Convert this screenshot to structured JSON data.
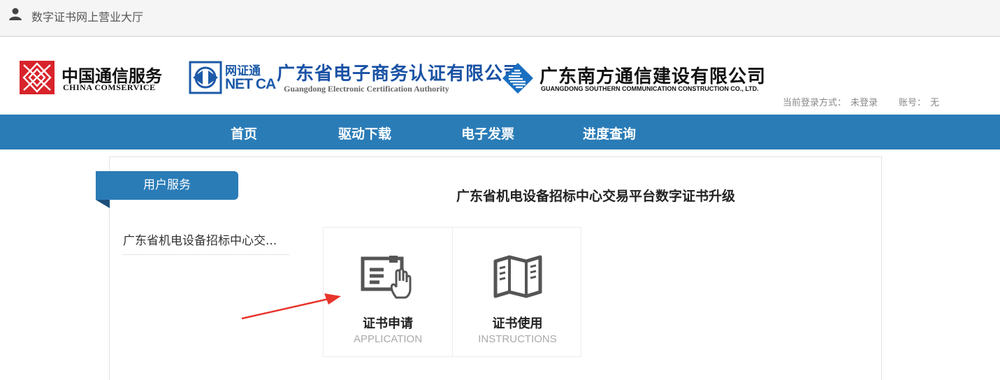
{
  "topbar": {
    "title": "数字证书网上营业大厅",
    "icon": "user-icon"
  },
  "logos": {
    "china_comservice": {
      "cn": "中国通信服务",
      "en": "CHINA COMSERVICE"
    },
    "netca": {
      "cn": "网证通",
      "en": "NET CA"
    },
    "gdca": {
      "cn": "广东省电子商务认证有限公司",
      "en": "Guangdong Electronic Certification Authority"
    },
    "gdsctc": {
      "cn": "广东南方通信建设有限公司",
      "en": "GUANGDONG SOUTHERN COMMUNICATION CONSTRUCTION CO., LTD."
    }
  },
  "login": {
    "method_label": "当前登录方式：",
    "method_value": "未登录",
    "account_label": "账号：",
    "account_value": "无"
  },
  "nav": [
    {
      "label": "首页"
    },
    {
      "label": "驱动下载"
    },
    {
      "label": "电子发票"
    },
    {
      "label": "进度查询"
    }
  ],
  "sidebar": {
    "header": "用户服务",
    "items": [
      {
        "label": "广东省机电设备招标中心交..."
      }
    ]
  },
  "main": {
    "title": "广东省机电设备招标中心交易平台数字证书升级",
    "cards": [
      {
        "title": "证书申请",
        "subtitle": "APPLICATION",
        "icon": "certificate-hand-icon"
      },
      {
        "title": "证书使用",
        "subtitle": "INSTRUCTIONS",
        "icon": "open-book-icon"
      }
    ]
  },
  "colors": {
    "accent": "#2a7cb7",
    "annotation_arrow": "#e8352c"
  }
}
